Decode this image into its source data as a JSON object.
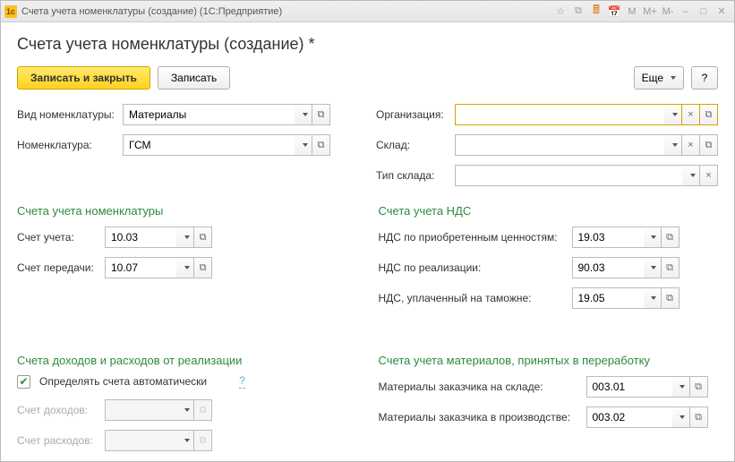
{
  "titlebar": {
    "title": "Счета учета номенклатуры (создание)  (1С:Предприятие)",
    "m": "M",
    "mplus": "M+",
    "mminus": "M-"
  },
  "page_title": "Счета учета номенклатуры (создание) *",
  "toolbar": {
    "save_close": "Записать и закрыть",
    "save": "Записать",
    "more": "Еще",
    "help": "?"
  },
  "form": {
    "nomenclature_type": {
      "label": "Вид номенклатуры:",
      "value": "Материалы"
    },
    "nomenclature": {
      "label": "Номенклатура:",
      "value": "ГСМ"
    },
    "organization": {
      "label": "Организация:",
      "value": ""
    },
    "warehouse": {
      "label": "Склад:",
      "value": ""
    },
    "warehouse_type": {
      "label": "Тип склада:",
      "value": ""
    }
  },
  "sections": {
    "accounts_nom": {
      "title": "Счета учета номенклатуры",
      "account": {
        "label": "Счет учета:",
        "value": "10.03"
      },
      "transfer": {
        "label": "Счет передачи:",
        "value": "10.07"
      }
    },
    "accounts_vat": {
      "title": "Счета учета НДС",
      "vat_purchased": {
        "label": "НДС по приобретенным ценностям:",
        "value": "19.03"
      },
      "vat_sales": {
        "label": "НДС по реализации:",
        "value": "90.03"
      },
      "vat_customs": {
        "label": "НДС, уплаченный на таможне:",
        "value": "19.05"
      }
    },
    "income_expense": {
      "title": "Счета доходов и расходов от реализации",
      "auto_checkbox_label": "Определять счета автоматически",
      "help": "?",
      "income": {
        "label": "Счет доходов:",
        "value": ""
      },
      "expense": {
        "label": "Счет расходов:",
        "value": ""
      }
    },
    "materials_proc": {
      "title": "Счета учета материалов, принятых в переработку",
      "customer_wh": {
        "label": "Материалы заказчика на складе:",
        "value": "003.01"
      },
      "customer_prod": {
        "label": "Материалы заказчика в производстве:",
        "value": "003.02"
      }
    }
  }
}
